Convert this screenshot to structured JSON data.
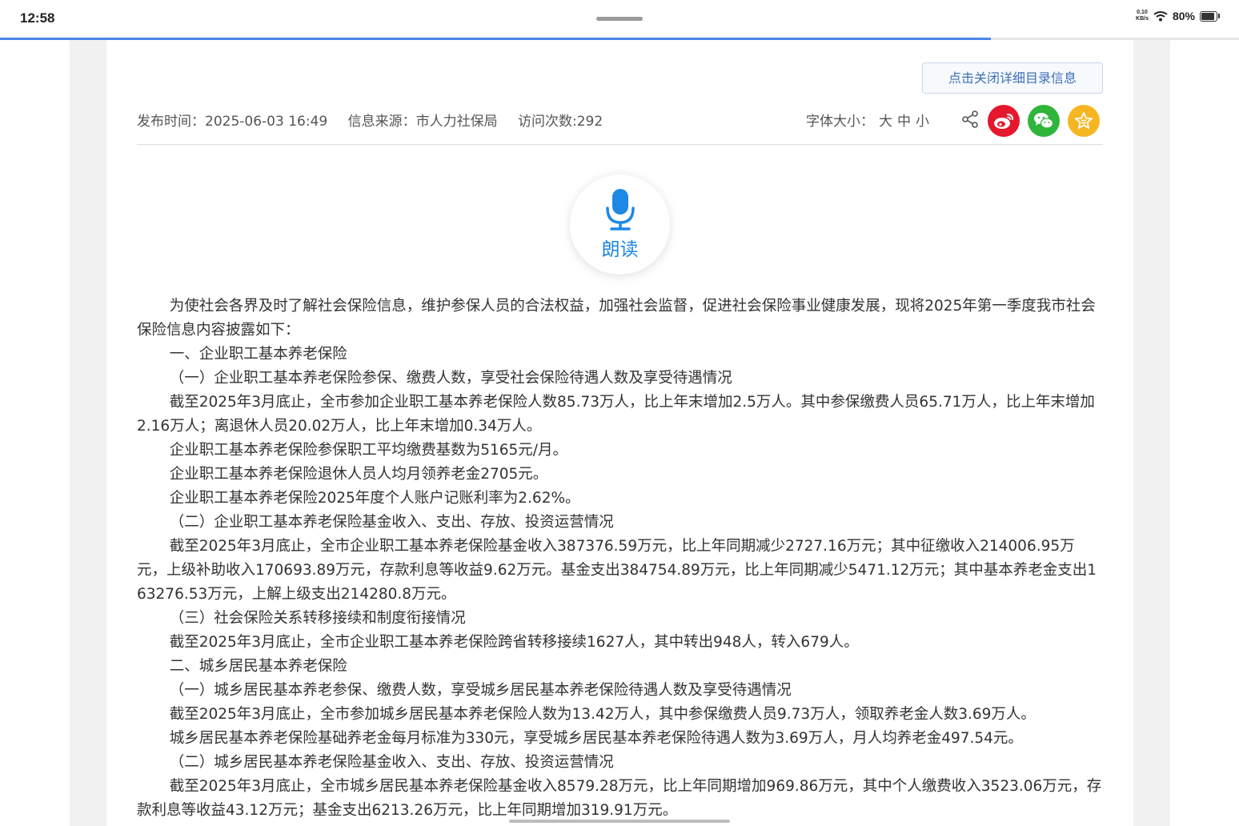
{
  "status": {
    "time": "12:58",
    "net_speed_top": "0.10",
    "net_speed_bottom": "KB/s",
    "battery": "80%",
    "battery_level": 0.8,
    "load_progress": 0.8
  },
  "toolbar": {
    "close_catalog_label": "点击关闭详细目录信息"
  },
  "meta": {
    "publish_time": "发布时间：2025-06-03 16:49",
    "source": "信息来源：市人力社保局",
    "visits": "访问次数:292",
    "font_size_label": "字体大小：",
    "font_large": "大",
    "font_medium": "中",
    "font_small": "小"
  },
  "read_aloud": {
    "label": "朗读"
  },
  "colors": {
    "accent": "#1e88e5",
    "weibo": "#e6162d",
    "wechat": "#2fb53a",
    "favorite": "#f5b622"
  },
  "icons": {
    "share": "share-icon",
    "weibo": "weibo-icon",
    "wechat": "wechat-icon",
    "favorite": "star-icon",
    "mic": "microphone-icon"
  },
  "article": {
    "paragraphs": [
      "为使社会各界及时了解社会保险信息，维护参保人员的合法权益，加强社会监督，促进社会保险事业健康发展，现将2025年第一季度我市社会保险信息内容披露如下：",
      "一、企业职工基本养老保险",
      "（一）企业职工基本养老保险参保、缴费人数，享受社会保险待遇人数及享受待遇情况",
      "截至2025年3月底止，全市参加企业职工基本养老保险人数85.73万人，比上年末增加2.5万人。其中参保缴费人员65.71万人，比上年末增加2.16万人；离退休人员20.02万人，比上年末增加0.34万人。",
      "企业职工基本养老保险参保职工平均缴费基数为5165元/月。",
      "企业职工基本养老保险退休人员人均月领养老金2705元。",
      "企业职工基本养老保险2025年度个人账户记账利率为2.62%。",
      "（二）企业职工基本养老保险基金收入、支出、存放、投资运营情况",
      "截至2025年3月底止，全市企业职工基本养老保险基金收入387376.59万元，比上年同期减少2727.16万元；其中征缴收入214006.95万元，上级补助收入170693.89万元，存款利息等收益9.62万元。基金支出384754.89万元，比上年同期减少5471.12万元；其中基本养老金支出163276.53万元，上解上级支出214280.8万元。",
      "（三）社会保险关系转移接续和制度衔接情况",
      "截至2025年3月底止，全市企业职工基本养老保险跨省转移接续1627人，其中转出948人，转入679人。",
      "二、城乡居民基本养老保险",
      "（一）城乡居民基本养老参保、缴费人数，享受城乡居民基本养老保险待遇人数及享受待遇情况",
      "截至2025年3月底止，全市参加城乡居民基本养老保险人数为13.42万人，其中参保缴费人员9.73万人，领取养老金人数3.69万人。",
      "城乡居民基本养老保险基础养老金每月标准为330元，享受城乡居民基本养老保险待遇人数为3.69万人，月人均养老金497.54元。",
      "（二）城乡居民基本养老保险基金收入、支出、存放、投资运营情况",
      "截至2025年3月底止，全市城乡居民基本养老保险基金收入8579.28万元，比上年同期增加969.86万元，其中个人缴费收入3523.06万元，存款利息等收益43.12万元；基金支出6213.26万元，比上年同期增加319.91万元。"
    ]
  }
}
